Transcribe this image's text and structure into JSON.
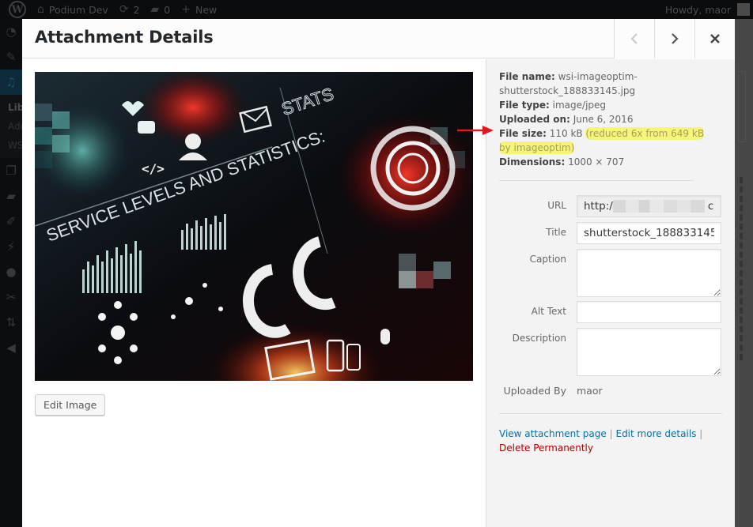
{
  "adminbar": {
    "site_name": "Podium Dev",
    "updates_count": "2",
    "comments_count": "0",
    "new_label": "New",
    "greeting": "Howdy, maor"
  },
  "sidemenu": {
    "submenu": [
      "Lib",
      "Add",
      "WS"
    ]
  },
  "modal": {
    "title": "Attachment Details",
    "prev_label": "Previous",
    "next_label": "Next",
    "close_label": "Close",
    "edit_image_label": "Edit Image",
    "preview_alt": "Service levels and statistics dashboard image",
    "preview_text": {
      "headline": "SERVICE LEVELS AND STATISTICS:",
      "stats": "STATS"
    }
  },
  "file_info": {
    "file_name_label": "File name:",
    "file_name": "wsi-imageoptim-shutterstock_188833145.jpg",
    "file_type_label": "File type:",
    "file_type": "image/jpeg",
    "uploaded_on_label": "Uploaded on:",
    "uploaded_on": "June 6, 2016",
    "file_size_label": "File size:",
    "file_size": "110 kB",
    "file_size_note": "(reduced 6x from 649 kB by imageoptim)",
    "dimensions_label": "Dimensions:",
    "dimensions": "1000 × 707"
  },
  "fields": {
    "url_label": "URL",
    "url_value_prefix": "http:/",
    "url_value_suffix": "c",
    "title_label": "Title",
    "title_value": "shutterstock_188833145",
    "caption_label": "Caption",
    "caption_value": "",
    "alt_label": "Alt Text",
    "alt_value": "",
    "description_label": "Description",
    "description_value": "",
    "uploaded_by_label": "Uploaded By",
    "uploaded_by_value": "maor"
  },
  "actions": {
    "view_attachment": "View attachment page",
    "edit_details": "Edit more details",
    "delete": "Delete Permanently",
    "separator": "|"
  },
  "colors": {
    "link": "#0073aa",
    "danger": "#aa0000",
    "highlight": "#f6f57a",
    "arrow": "#e3171d"
  }
}
